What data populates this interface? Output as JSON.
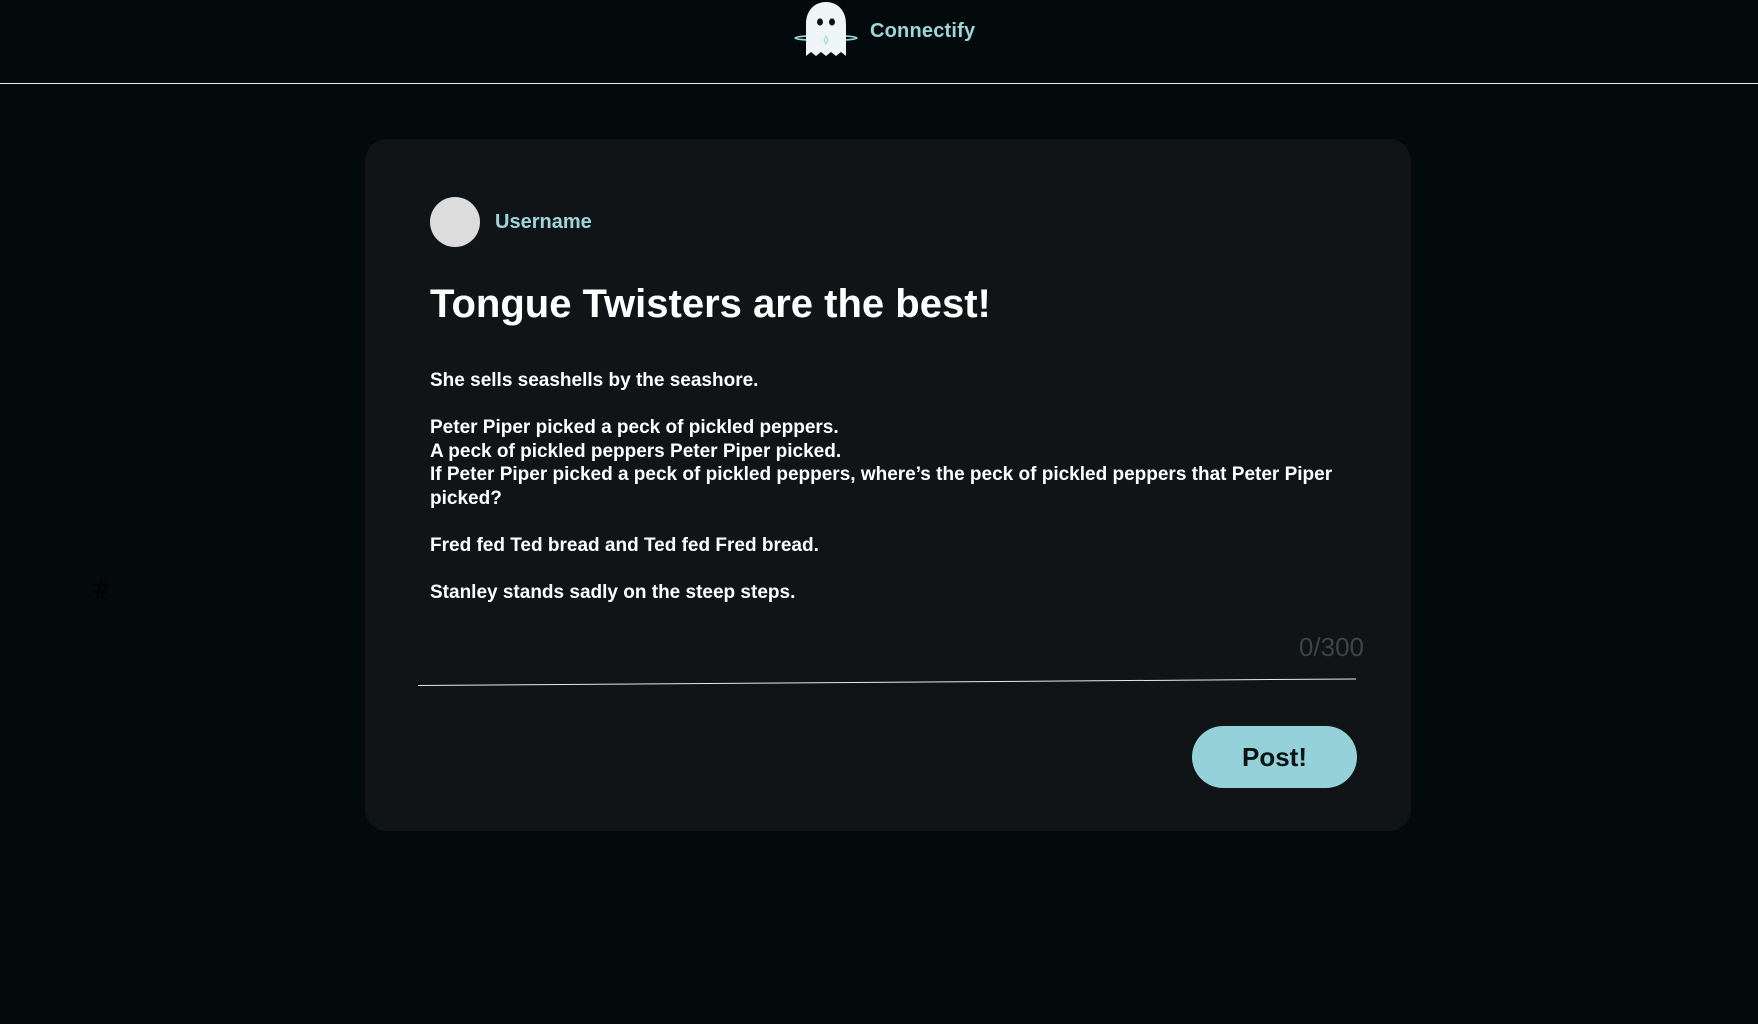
{
  "app": {
    "name": "Connectify",
    "logo_icon": "ghost-icon",
    "accent_color": "#9ed6dc"
  },
  "post": {
    "username": "Username",
    "title": "Tongue Twisters are the best!",
    "paragraphs": [
      [
        "She sells seashells by the seashore."
      ],
      [
        "Peter Piper picked a peck of pickled peppers.",
        "A peck of pickled peppers Peter Piper picked.",
        "If Peter Piper picked a peck of pickled peppers, where’s the peck of pickled peppers that Peter Piper picked?"
      ],
      [
        "Fred fed Ted bread and Ted fed Fred bread."
      ],
      [
        "Stanley stands sadly on the steep steps."
      ]
    ],
    "char_counter": "0/300",
    "submit_label": "Post!"
  },
  "misc": {
    "hash_glyph": "#"
  }
}
